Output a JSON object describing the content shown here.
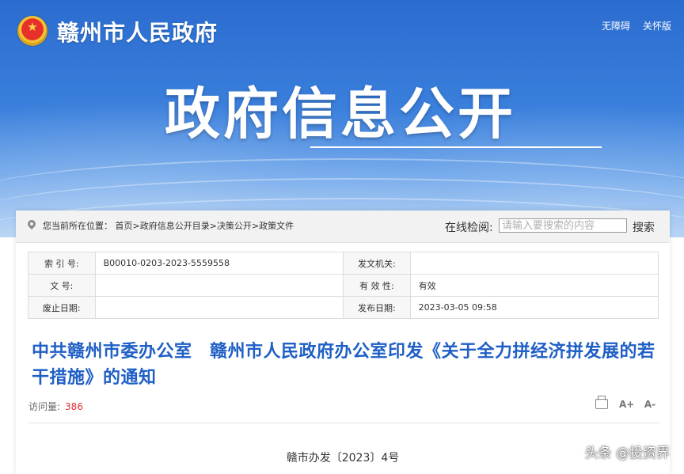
{
  "header": {
    "site_name": "赣州市人民政府",
    "links": [
      "无障碍",
      "关怀版"
    ],
    "hero_title": "政府信息公开"
  },
  "breadcrumb": {
    "prefix": "您当前所在位置：",
    "items": [
      "首页",
      "政府信息公开目录",
      "决策公开",
      "政策文件"
    ],
    "separator": ">"
  },
  "search": {
    "label": "在线检阅:",
    "placeholder": "请输入要搜索的内容",
    "button": "搜索"
  },
  "meta": {
    "rows": [
      {
        "k1": "索 引 号:",
        "v1": "B00010-0203-2023-5559558",
        "k2": "发文机关:",
        "v2": ""
      },
      {
        "k1": "文 号:",
        "v1": "",
        "k2": "有 效 性:",
        "v2": "有效"
      },
      {
        "k1": "废止日期:",
        "v1": "",
        "k2": "发布日期:",
        "v2": "2023-03-05 09:58"
      }
    ]
  },
  "document": {
    "title": "中共赣州市委办公室　赣州市人民政府办公室印发《关于全力拼经济拼发展的若干措施》的通知",
    "visits_label": "访问量:",
    "visits_count": "386",
    "number": "赣市办发〔2023〕4号"
  },
  "tools": {
    "font_up": "A+",
    "font_down": "A-"
  },
  "watermark": "头条 @投资界"
}
